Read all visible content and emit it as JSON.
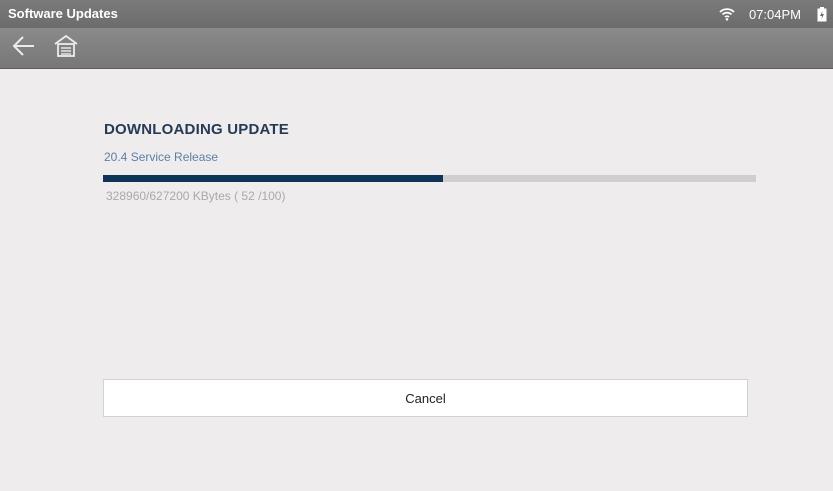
{
  "status_bar": {
    "title": "Software Updates",
    "time": "07:04PM",
    "icons": [
      "wifi-icon",
      "battery-icon"
    ]
  },
  "nav": {
    "icons": [
      "back-arrow-icon",
      "home-icon"
    ]
  },
  "download": {
    "heading": "DOWNLOADING UPDATE",
    "release_name": "20.4 Service Release",
    "progress_percent": 52,
    "progress_text": "328960/627200 KBytes ( 52 /100)"
  },
  "actions": {
    "cancel_label": "Cancel"
  },
  "colors": {
    "accent": "#0e3559",
    "heading": "#253a55",
    "subheading": "#5d7fa6",
    "track": "#cfcfcf"
  }
}
